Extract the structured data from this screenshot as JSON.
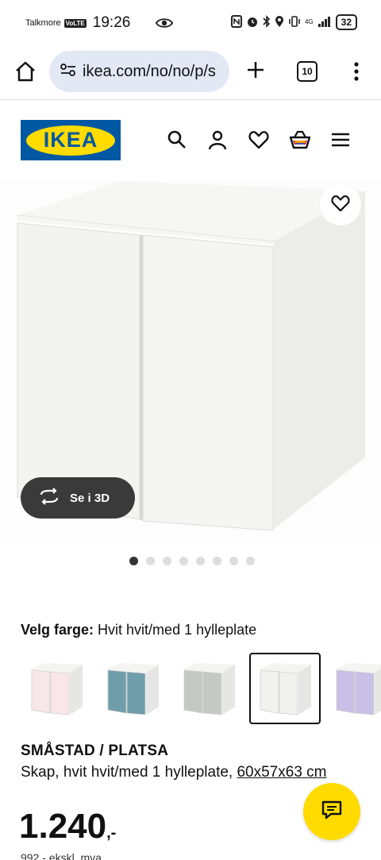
{
  "status_bar": {
    "carrier": "Talkmore",
    "volte": "VoLTE",
    "time": "19:26",
    "network": "4G",
    "battery": "32"
  },
  "browser": {
    "url": "ikea.com/no/no/p/s",
    "tab_count": "10"
  },
  "header": {
    "logo_text": "IKEA",
    "icons": [
      "search-icon",
      "account-icon",
      "favourites-icon",
      "cart-icon",
      "menu-icon"
    ]
  },
  "product_image": {
    "view_3d_label": "Se i 3D",
    "carousel_count": 8,
    "carousel_active": 0
  },
  "color_select": {
    "label": "Velg farge:",
    "value": "Hvit hvit/med 1 hylleplate",
    "swatches": [
      {
        "name": "pink",
        "door": "#f8e6ea"
      },
      {
        "name": "blue",
        "door": "#6f9eaa"
      },
      {
        "name": "grey",
        "door": "#c6c9c3"
      },
      {
        "name": "white",
        "door": "#f1f1ee"
      },
      {
        "name": "lilac",
        "door": "#c8c0e6"
      }
    ],
    "selected_index": 3
  },
  "product": {
    "name": "SMÅSTAD / PLATSA",
    "description": "Skap, hvit hvit/med 1 hylleplate, ",
    "dimensions": "60x57x63 cm",
    "price": "1.240",
    "price_suffix": ",-",
    "price_ex_vat": "992,- ekskl. mva"
  },
  "colors": {
    "ikea_blue": "#0058a3",
    "ikea_yellow": "#ffdb00",
    "url_bg": "#e3e8f5"
  }
}
